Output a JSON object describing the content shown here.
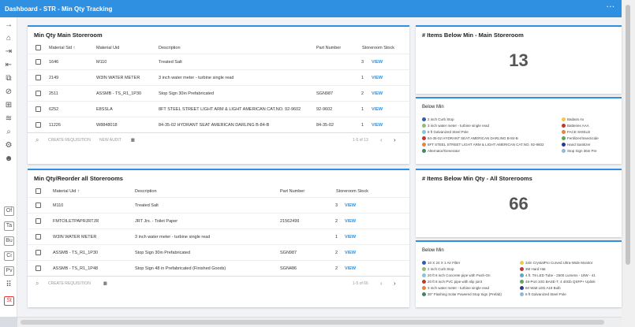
{
  "app": {
    "title": "Dashboard - STR - Min Qty Tracking",
    "more_label": "···"
  },
  "sidebar": {
    "icons": [
      "arrow-right-icon",
      "home-icon",
      "export-icon",
      "import-icon",
      "copy-icon",
      "block-icon",
      "add-box-icon",
      "layers-icon",
      "search-icon",
      "settings-icon",
      "user-icon"
    ],
    "boxes": [
      "Of",
      "Ta",
      "Bu",
      "Ci",
      "Pv",
      "",
      "St"
    ]
  },
  "main_table": {
    "title": "Min Qty Main Storeroom",
    "headers": {
      "sid": "Material Sid ↑",
      "uid": "Material Uid",
      "desc": "Description",
      "part": "Part Number",
      "stock": "Storeroom Stock"
    },
    "rows": [
      {
        "sid": "1646",
        "uid": "M110",
        "desc": "Treated Salt",
        "part": "",
        "stock": "3",
        "view": "VIEW"
      },
      {
        "sid": "2149",
        "uid": "W3IN WATER METER",
        "desc": "3 inch water meter - turbine single read",
        "part": "",
        "stock": "1",
        "view": "VIEW"
      },
      {
        "sid": "2511",
        "uid": "ASSMB - TS_R1_1P30",
        "desc": "Stop Sign 30in Prefabricated",
        "part": "SGN987",
        "stock": "2",
        "view": "VIEW"
      },
      {
        "sid": "6252",
        "uid": "E8SSLA",
        "desc": "8FT STEEL STREET LIGHT ARM & LIGHT AMERICAN CAT.NO. 92-9602",
        "part": "92-9602",
        "stock": "1",
        "view": "VIEW"
      },
      {
        "sid": "11226",
        "uid": "W8848018",
        "desc": "84-35-02 HYDRANT SEAT AMERICAN DARLING B-84-B",
        "part": "84-35-02",
        "stock": "1",
        "view": "VIEW"
      }
    ],
    "toolbar": {
      "create": "CREATE REQUISITION",
      "audit": "NEW AUDIT",
      "pager": "1-5 of 13"
    }
  },
  "reorder_table": {
    "title": "Min Qty/Reorder all Storerooms",
    "headers": {
      "uid": "Material Uid ↑",
      "desc": "Description",
      "part": "Part Number",
      "stock": "Storeroom Stock"
    },
    "rows": [
      {
        "uid": "M110",
        "desc": "Treated Salt",
        "part": "",
        "stock": "3",
        "view": "VIEW"
      },
      {
        "uid": "FMTOILETPAPRJRTJR",
        "desc": "JRT Jrs. - Toilet Paper",
        "part": "21562499",
        "stock": "2",
        "view": "VIEW"
      },
      {
        "uid": "W3IN WATER METER",
        "desc": "3 inch water meter - turbine single read",
        "part": "",
        "stock": "1",
        "view": "VIEW"
      },
      {
        "uid": "ASSMB - TS_R1_1P30",
        "desc": "Stop Sign 30in Prefabricated",
        "part": "SGN987",
        "stock": "2",
        "view": "VIEW"
      },
      {
        "uid": "ASSMB - TS_R1_1P48",
        "desc": "Stop Sign 48 in Prefabricated (Finished Goods)",
        "part": "SGN486",
        "stock": "2",
        "view": "VIEW"
      }
    ],
    "toolbar": {
      "create": "CREATE REQUISITION",
      "pager": "1-5 of 66"
    }
  },
  "kpi_main": {
    "title": "# Items Below Min - Main Storeroom",
    "value": "13"
  },
  "kpi_all": {
    "title": "# Items Below Min Qty - All Storerooms",
    "value": "66"
  },
  "legend_main": {
    "title": "Below Min",
    "left": [
      {
        "label": "2 inch Curb Stop",
        "color": "#2b5fb4"
      },
      {
        "label": "3 inch water meter - turbine single read",
        "color": "#8fbf6b"
      },
      {
        "label": "8 ft Galvanized Steel Pole",
        "color": "#7fc8d8"
      },
      {
        "label": "84-35-02 HYDRANT SEAT AMERICAN DARLING B-84-B",
        "color": "#c0392b"
      },
      {
        "label": "8FT STEEL STREET LIGHT ARM & LIGHT AMERICAN CAT.NO. 92-9602",
        "color": "#e0883a"
      },
      {
        "label": "Alternator/Generator",
        "color": "#3c8a5a"
      }
    ],
    "right": [
      {
        "label": "Badass Ax",
        "color": "#f1c84b"
      },
      {
        "label": "Batteries AAA",
        "color": "#c0392b"
      },
      {
        "label": "FACE SHIELD",
        "color": "#e0883a"
      },
      {
        "label": "Fertilizer/Insecticide",
        "color": "#5aa85a"
      },
      {
        "label": "Hand Sanitizer",
        "color": "#2b3a8f"
      },
      {
        "label": "Stop Sign 36in Pre",
        "color": "#8fb8d8"
      }
    ]
  },
  "legend_all": {
    "title": "Below Min",
    "left": [
      {
        "label": "10 X 24 X 1 Air Filter",
        "color": "#2b5fb4"
      },
      {
        "label": "2 inch Curb Stop",
        "color": "#8fbf6b"
      },
      {
        "label": "20 ft 6 inch Concrete pipe with Push-On",
        "color": "#7fc8d8"
      },
      {
        "label": "20 ft 8 inch PVC pipe with slip joint",
        "color": "#c0392b"
      },
      {
        "label": "3 inch water meter - turbine single read",
        "color": "#e0883a"
      },
      {
        "label": "30\" Flashing Solar Powered Stop Sign (Prefab)",
        "color": "#3c8a5a"
      }
    ],
    "right": [
      {
        "label": "34in CrystalPro Curved Ultra-Wide Monitor",
        "color": "#f1c84b"
      },
      {
        "label": "3M Hard Hat",
        "color": "#c0392b"
      },
      {
        "label": "4 ft. T8 LED Tube - 2500 Lumens - 18W - 41",
        "color": "#5aa8c8"
      },
      {
        "label": "48-Port 10G BASE-T, 4 40Gb QSFP+ Uplink",
        "color": "#5aa85a"
      },
      {
        "label": "60 Watt LED A19 Bulb",
        "color": "#2b3a8f"
      },
      {
        "label": "8 ft Galvanized Steel Pole",
        "color": "#8fb8d8"
      }
    ]
  }
}
